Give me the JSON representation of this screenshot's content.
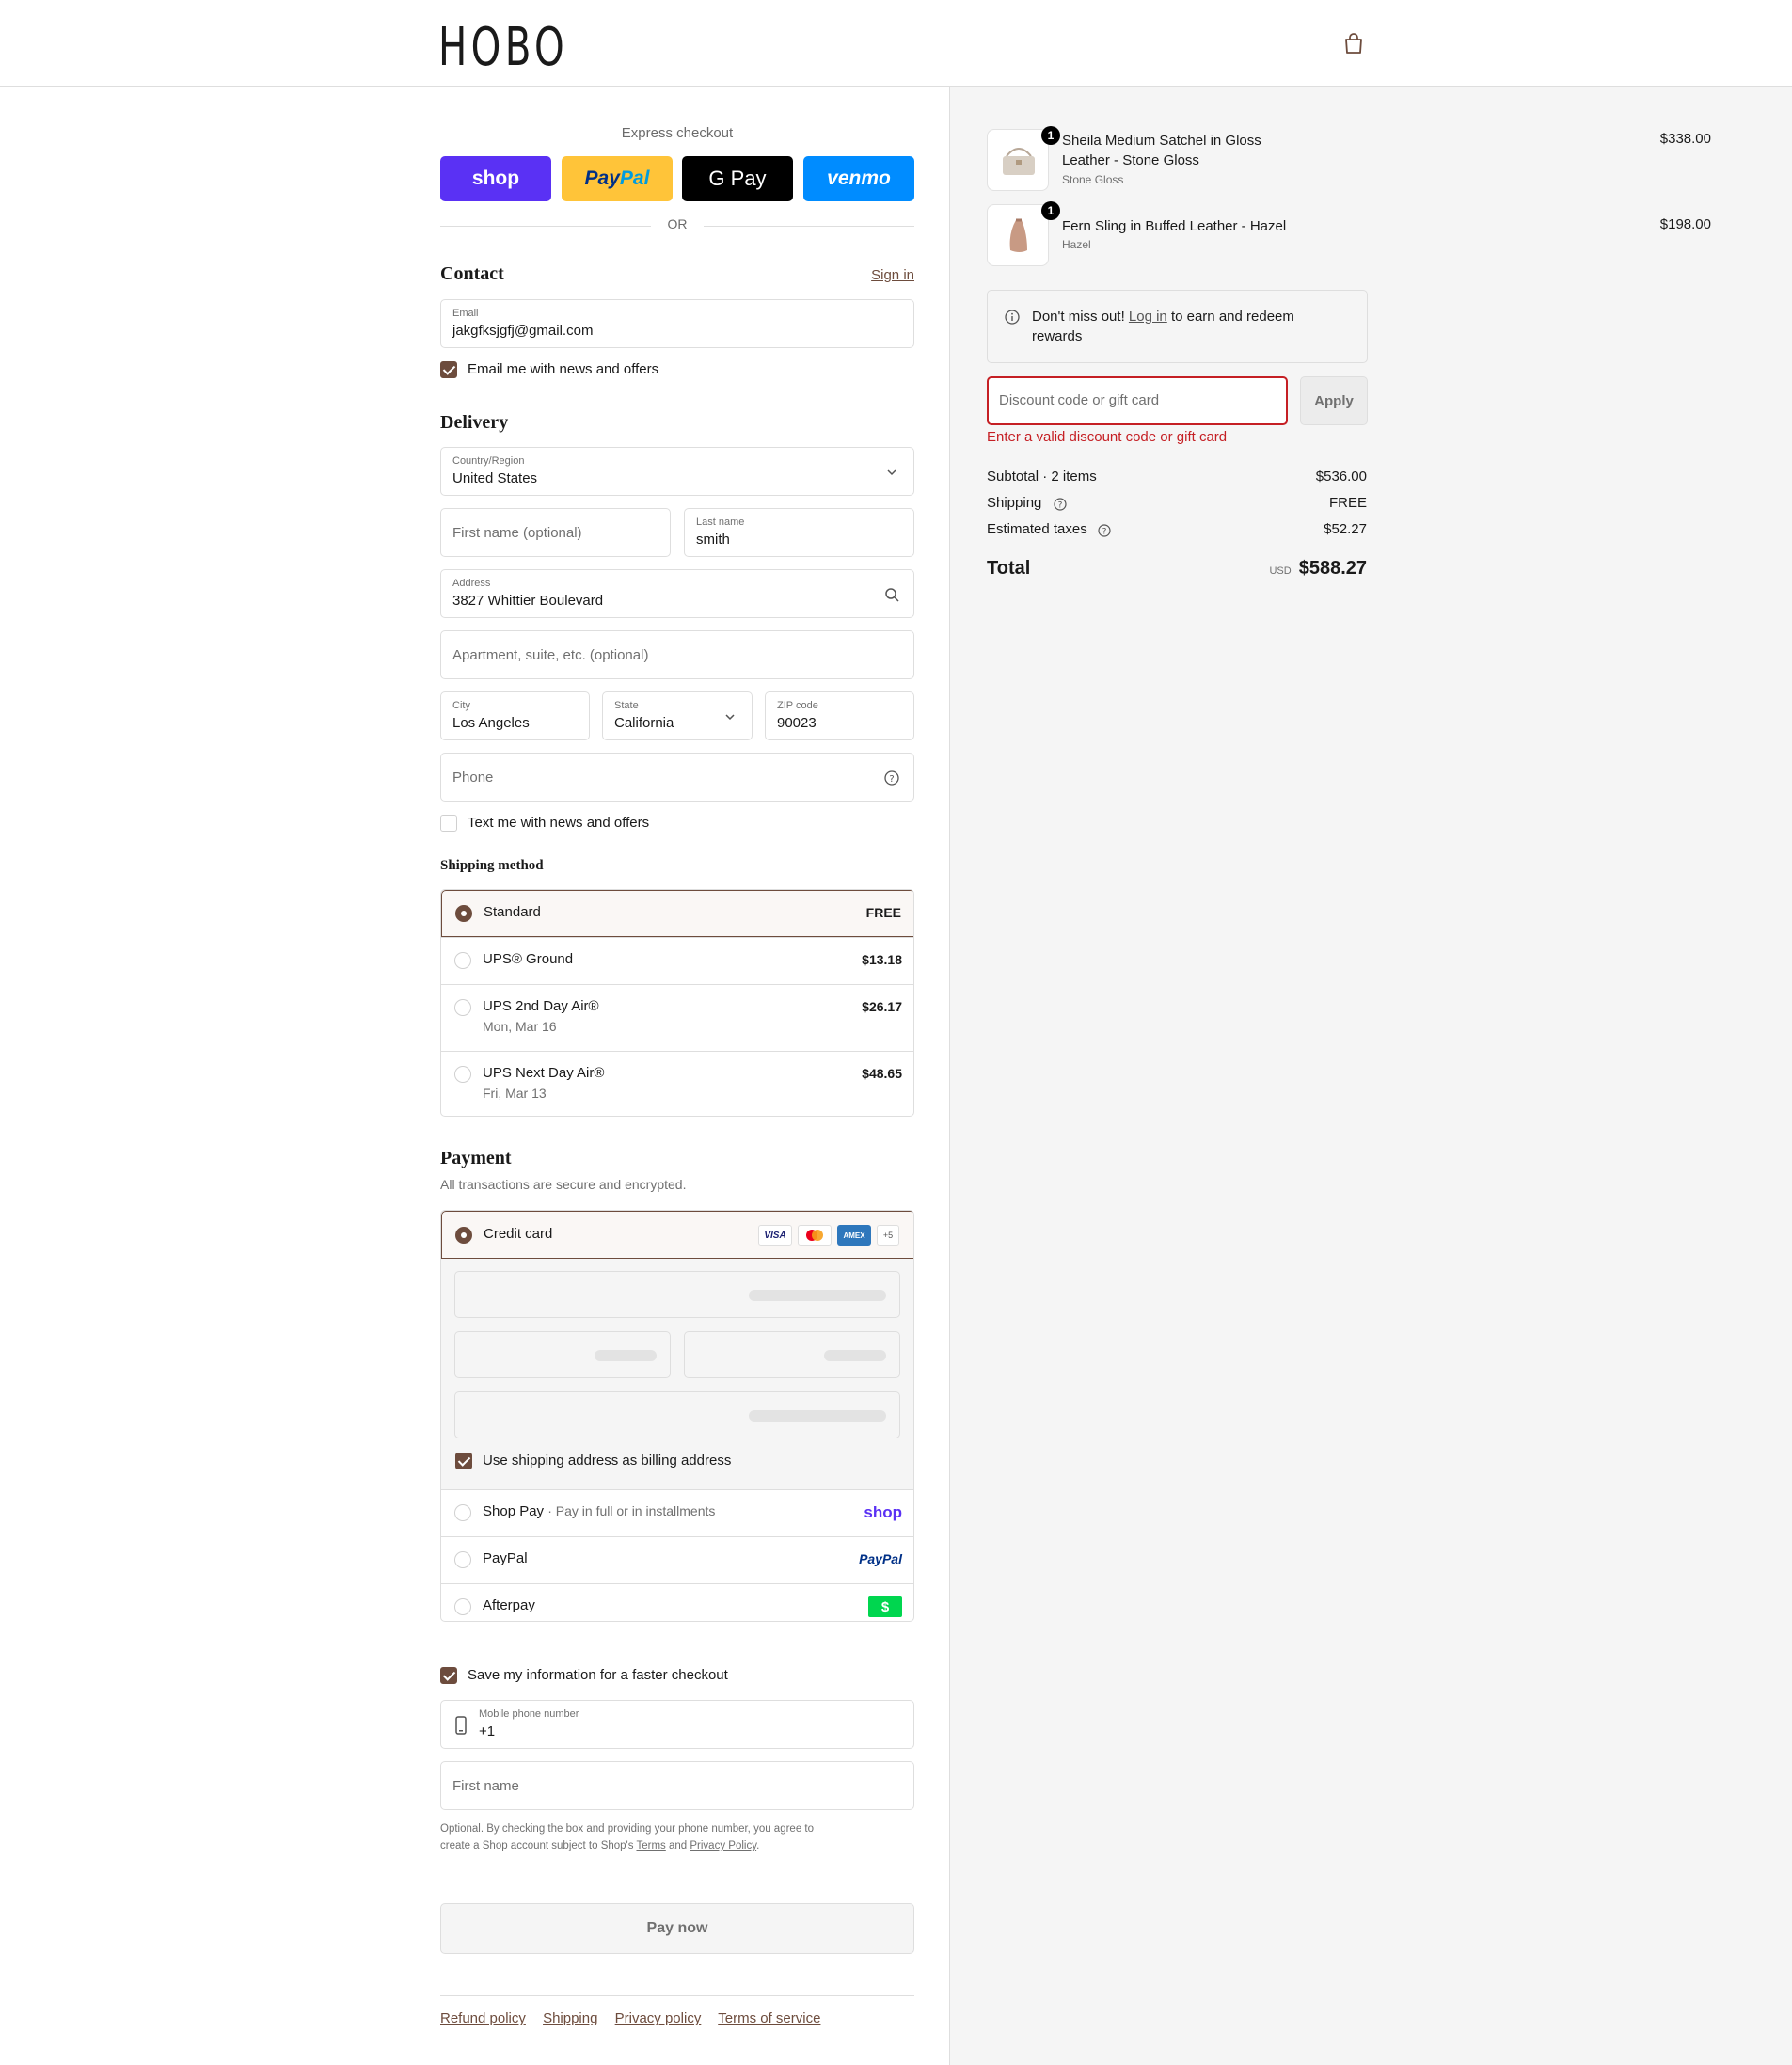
{
  "header": {
    "logo": "HOBO"
  },
  "express": {
    "title": "Express checkout",
    "buttons": {
      "shop": "shop",
      "paypal_a": "Pay",
      "paypal_b": "Pal",
      "gpay": "G Pay",
      "venmo": "venmo"
    },
    "or": "OR"
  },
  "contact": {
    "title": "Contact",
    "sign_in": "Sign in",
    "email_label": "Email",
    "email_value": "jakgfksjgfj@gmail.com",
    "news_label": "Email me with news and offers",
    "news_checked": true
  },
  "delivery": {
    "title": "Delivery",
    "country_label": "Country/Region",
    "country_value": "United States",
    "first_name_placeholder": "First name (optional)",
    "last_name_label": "Last name",
    "last_name_value": "smith",
    "address_label": "Address",
    "address_value": "3827 Whittier Boulevard",
    "apt_placeholder": "Apartment, suite, etc. (optional)",
    "city_label": "City",
    "city_value": "Los Angeles",
    "state_label": "State",
    "state_value": "California",
    "zip_label": "ZIP code",
    "zip_value": "90023",
    "phone_placeholder": "Phone",
    "text_label": "Text me with news and offers"
  },
  "shipping_method": {
    "title": "Shipping method",
    "options": [
      {
        "name": "Standard",
        "sub": "",
        "price": "FREE"
      },
      {
        "name": "UPS® Ground",
        "sub": "",
        "price": "$13.18"
      },
      {
        "name": "UPS 2nd Day Air®",
        "sub": "Mon, Mar 16",
        "price": "$26.17"
      },
      {
        "name": "UPS Next Day Air®",
        "sub": "Fri, Mar 13",
        "price": "$48.65"
      }
    ]
  },
  "payment": {
    "title": "Payment",
    "subtitle": "All transactions are secure and encrypted.",
    "credit_card": "Credit card",
    "card_icons": {
      "visa": "VISA",
      "amex": "AMEX",
      "more": "+5"
    },
    "billing_label": "Use shipping address as billing address",
    "shop_pay": "Shop Pay",
    "shop_pay_sub": "· Pay in full or in installments",
    "shop_pay_logo": "shop",
    "paypal": "PayPal",
    "paypal_logo": "PayPal",
    "afterpay": "Afterpay",
    "afterpay_logo": "$"
  },
  "save_info": {
    "label": "Save my information for a faster checkout",
    "mobile_label": "Mobile phone number",
    "mobile_value": "+1",
    "first_name_placeholder": "First name",
    "legal_a": "Optional. By checking the box and providing your phone number, you agree to",
    "legal_b": "create a Shop account subject to Shop's ",
    "terms": "Terms",
    "and": " and ",
    "privacy": "Privacy Policy",
    "period": "."
  },
  "pay_now": "Pay now",
  "footer": [
    "Refund policy",
    "Shipping",
    "Privacy policy",
    "Terms of service"
  ],
  "cart": {
    "items": [
      {
        "qty": "1",
        "name_line1": "Sheila Medium Satchel in Gloss",
        "name_line2": "Leather - Stone Gloss",
        "variant": "Stone Gloss",
        "price": "$338.00"
      },
      {
        "qty": "1",
        "name_line1": "Fern Sling in Buffed Leather - Hazel",
        "name_line2": "",
        "variant": "Hazel",
        "price": "$198.00"
      }
    ],
    "rewards_a": "Don't miss out! ",
    "rewards_link": "Log in",
    "rewards_b": " to earn and redeem",
    "rewards_c": "rewards",
    "discount_placeholder": "Discount code or gift card",
    "apply": "Apply",
    "discount_error": "Enter a valid discount code or gift card",
    "subtotal_label": "Subtotal · 2 items",
    "subtotal_value": "$536.00",
    "shipping_label": "Shipping",
    "shipping_value": "FREE",
    "taxes_label": "Estimated taxes",
    "taxes_value": "$52.27",
    "total_label": "Total",
    "currency": "USD",
    "total_value": "$588.27"
  }
}
